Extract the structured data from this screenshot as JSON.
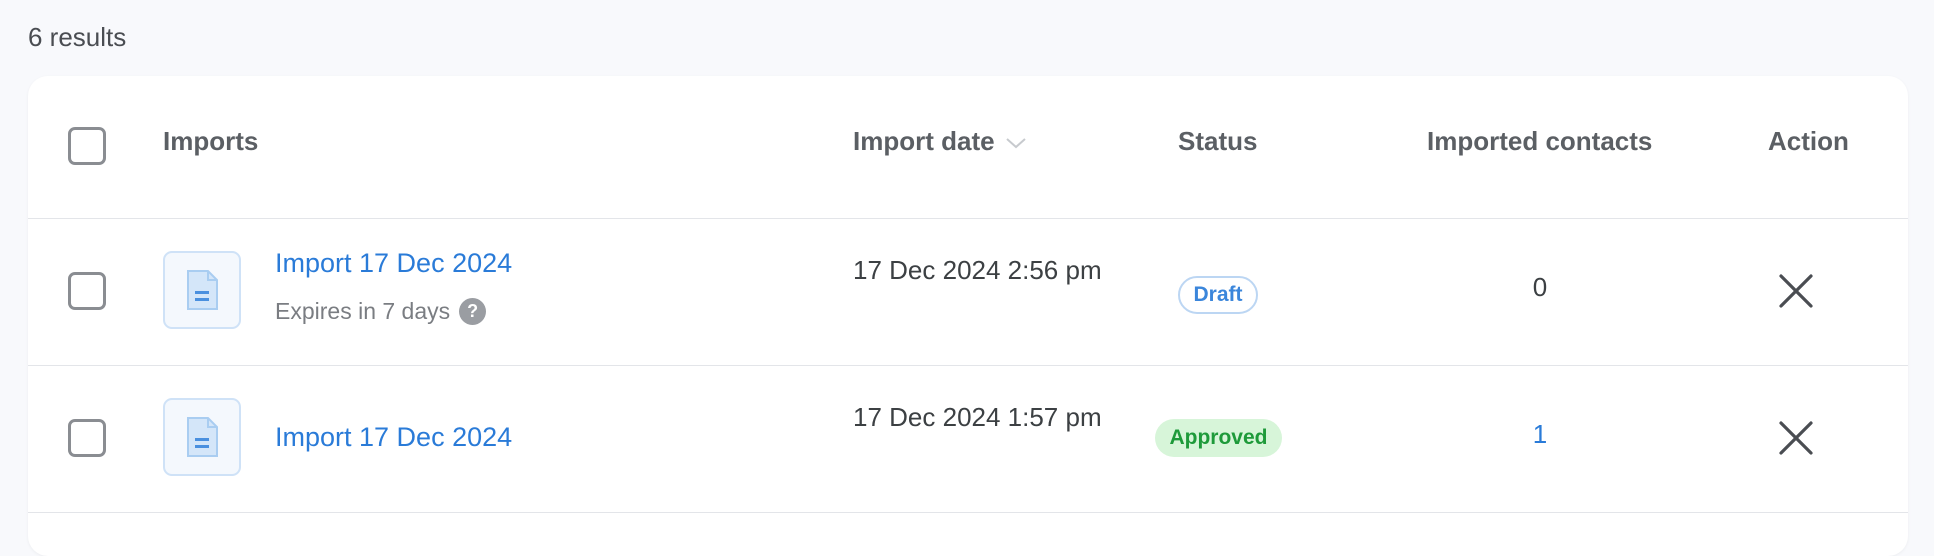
{
  "results": {
    "count_text": "6 results"
  },
  "table": {
    "headers": {
      "imports": "Imports",
      "import_date": "Import date",
      "status": "Status",
      "imported_contacts": "Imported contacts",
      "action": "Action"
    },
    "sort_icon": "chevron-down-icon",
    "rows": [
      {
        "name": "Import 17 Dec 2024",
        "expires": "Expires in 7 days",
        "help_icon": "?",
        "date": "17 Dec 2024 2:56 pm",
        "status": "Draft",
        "contacts": "0"
      },
      {
        "name": "Import 17 Dec 2024",
        "date": "17 Dec 2024 1:57 pm",
        "status": "Approved",
        "contacts": "1"
      }
    ]
  },
  "colors": {
    "link": "#2a7bd8",
    "draft_border": "#bcd6f3",
    "approved_bg": "#d7f5d9",
    "approved_text": "#1e9a3a"
  }
}
